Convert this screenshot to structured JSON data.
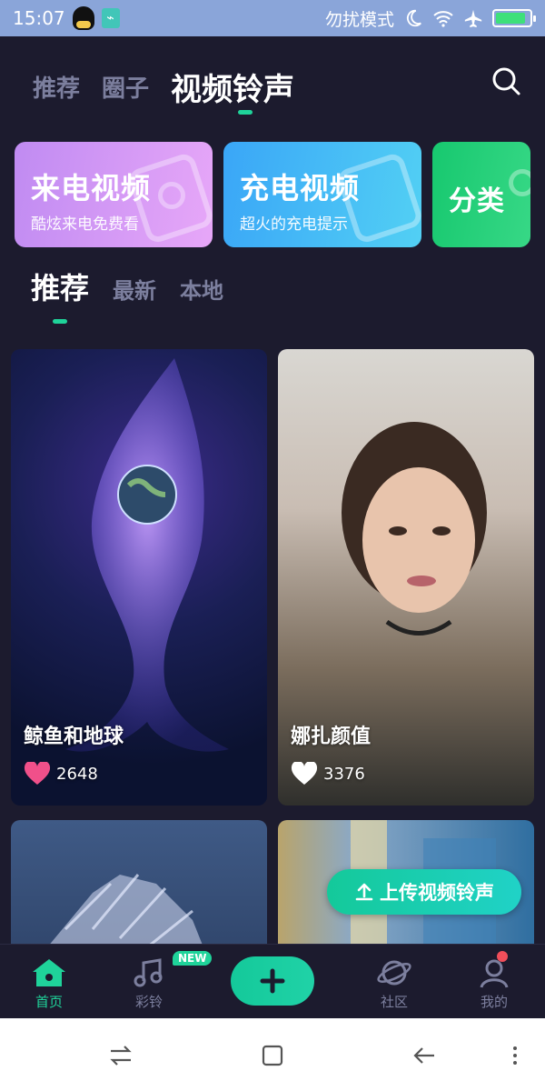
{
  "status_bar": {
    "time": "15:07",
    "dnd_label": "勿扰模式",
    "battery_level": 0.9
  },
  "top_nav": {
    "tabs": [
      {
        "label": "推荐",
        "active": false
      },
      {
        "label": "圈子",
        "active": false
      },
      {
        "label": "视频铃声",
        "active": true
      }
    ],
    "search_icon": "search-icon"
  },
  "features": [
    {
      "title": "来电视频",
      "subtitle": "酷炫来电免费看",
      "color": "#d89bf5"
    },
    {
      "title": "充电视频",
      "subtitle": "超火的充电提示",
      "color": "#45bcf5"
    },
    {
      "title": "分类",
      "subtitle": "",
      "color": "#22cf79"
    }
  ],
  "sub_tabs": [
    {
      "label": "推荐",
      "active": true
    },
    {
      "label": "最新",
      "active": false
    },
    {
      "label": "本地",
      "active": false
    }
  ],
  "videos": [
    {
      "title": "鲸鱼和地球",
      "likes": "2648",
      "liked": true
    },
    {
      "title": "娜扎颜值",
      "likes": "3376",
      "liked": false
    },
    {
      "title": "",
      "likes": "",
      "liked": false
    },
    {
      "title": "",
      "likes": "",
      "liked": false
    }
  ],
  "upload_button": {
    "label": "上传视频铃声"
  },
  "bottom_nav": {
    "items": [
      {
        "label": "首页",
        "icon": "home-icon",
        "active": true
      },
      {
        "label": "彩铃",
        "icon": "music-note-icon",
        "active": false
      },
      {
        "label": "社区",
        "icon": "planet-icon",
        "active": false
      },
      {
        "label": "我的",
        "icon": "person-icon",
        "active": false
      }
    ],
    "new_badge": "NEW",
    "add_icon": "plus-icon"
  },
  "colors": {
    "accent": "#1fd39a",
    "background": "#1c1b2e",
    "inactive_text": "#7c7f9e",
    "like_heart": "#f0508a"
  }
}
